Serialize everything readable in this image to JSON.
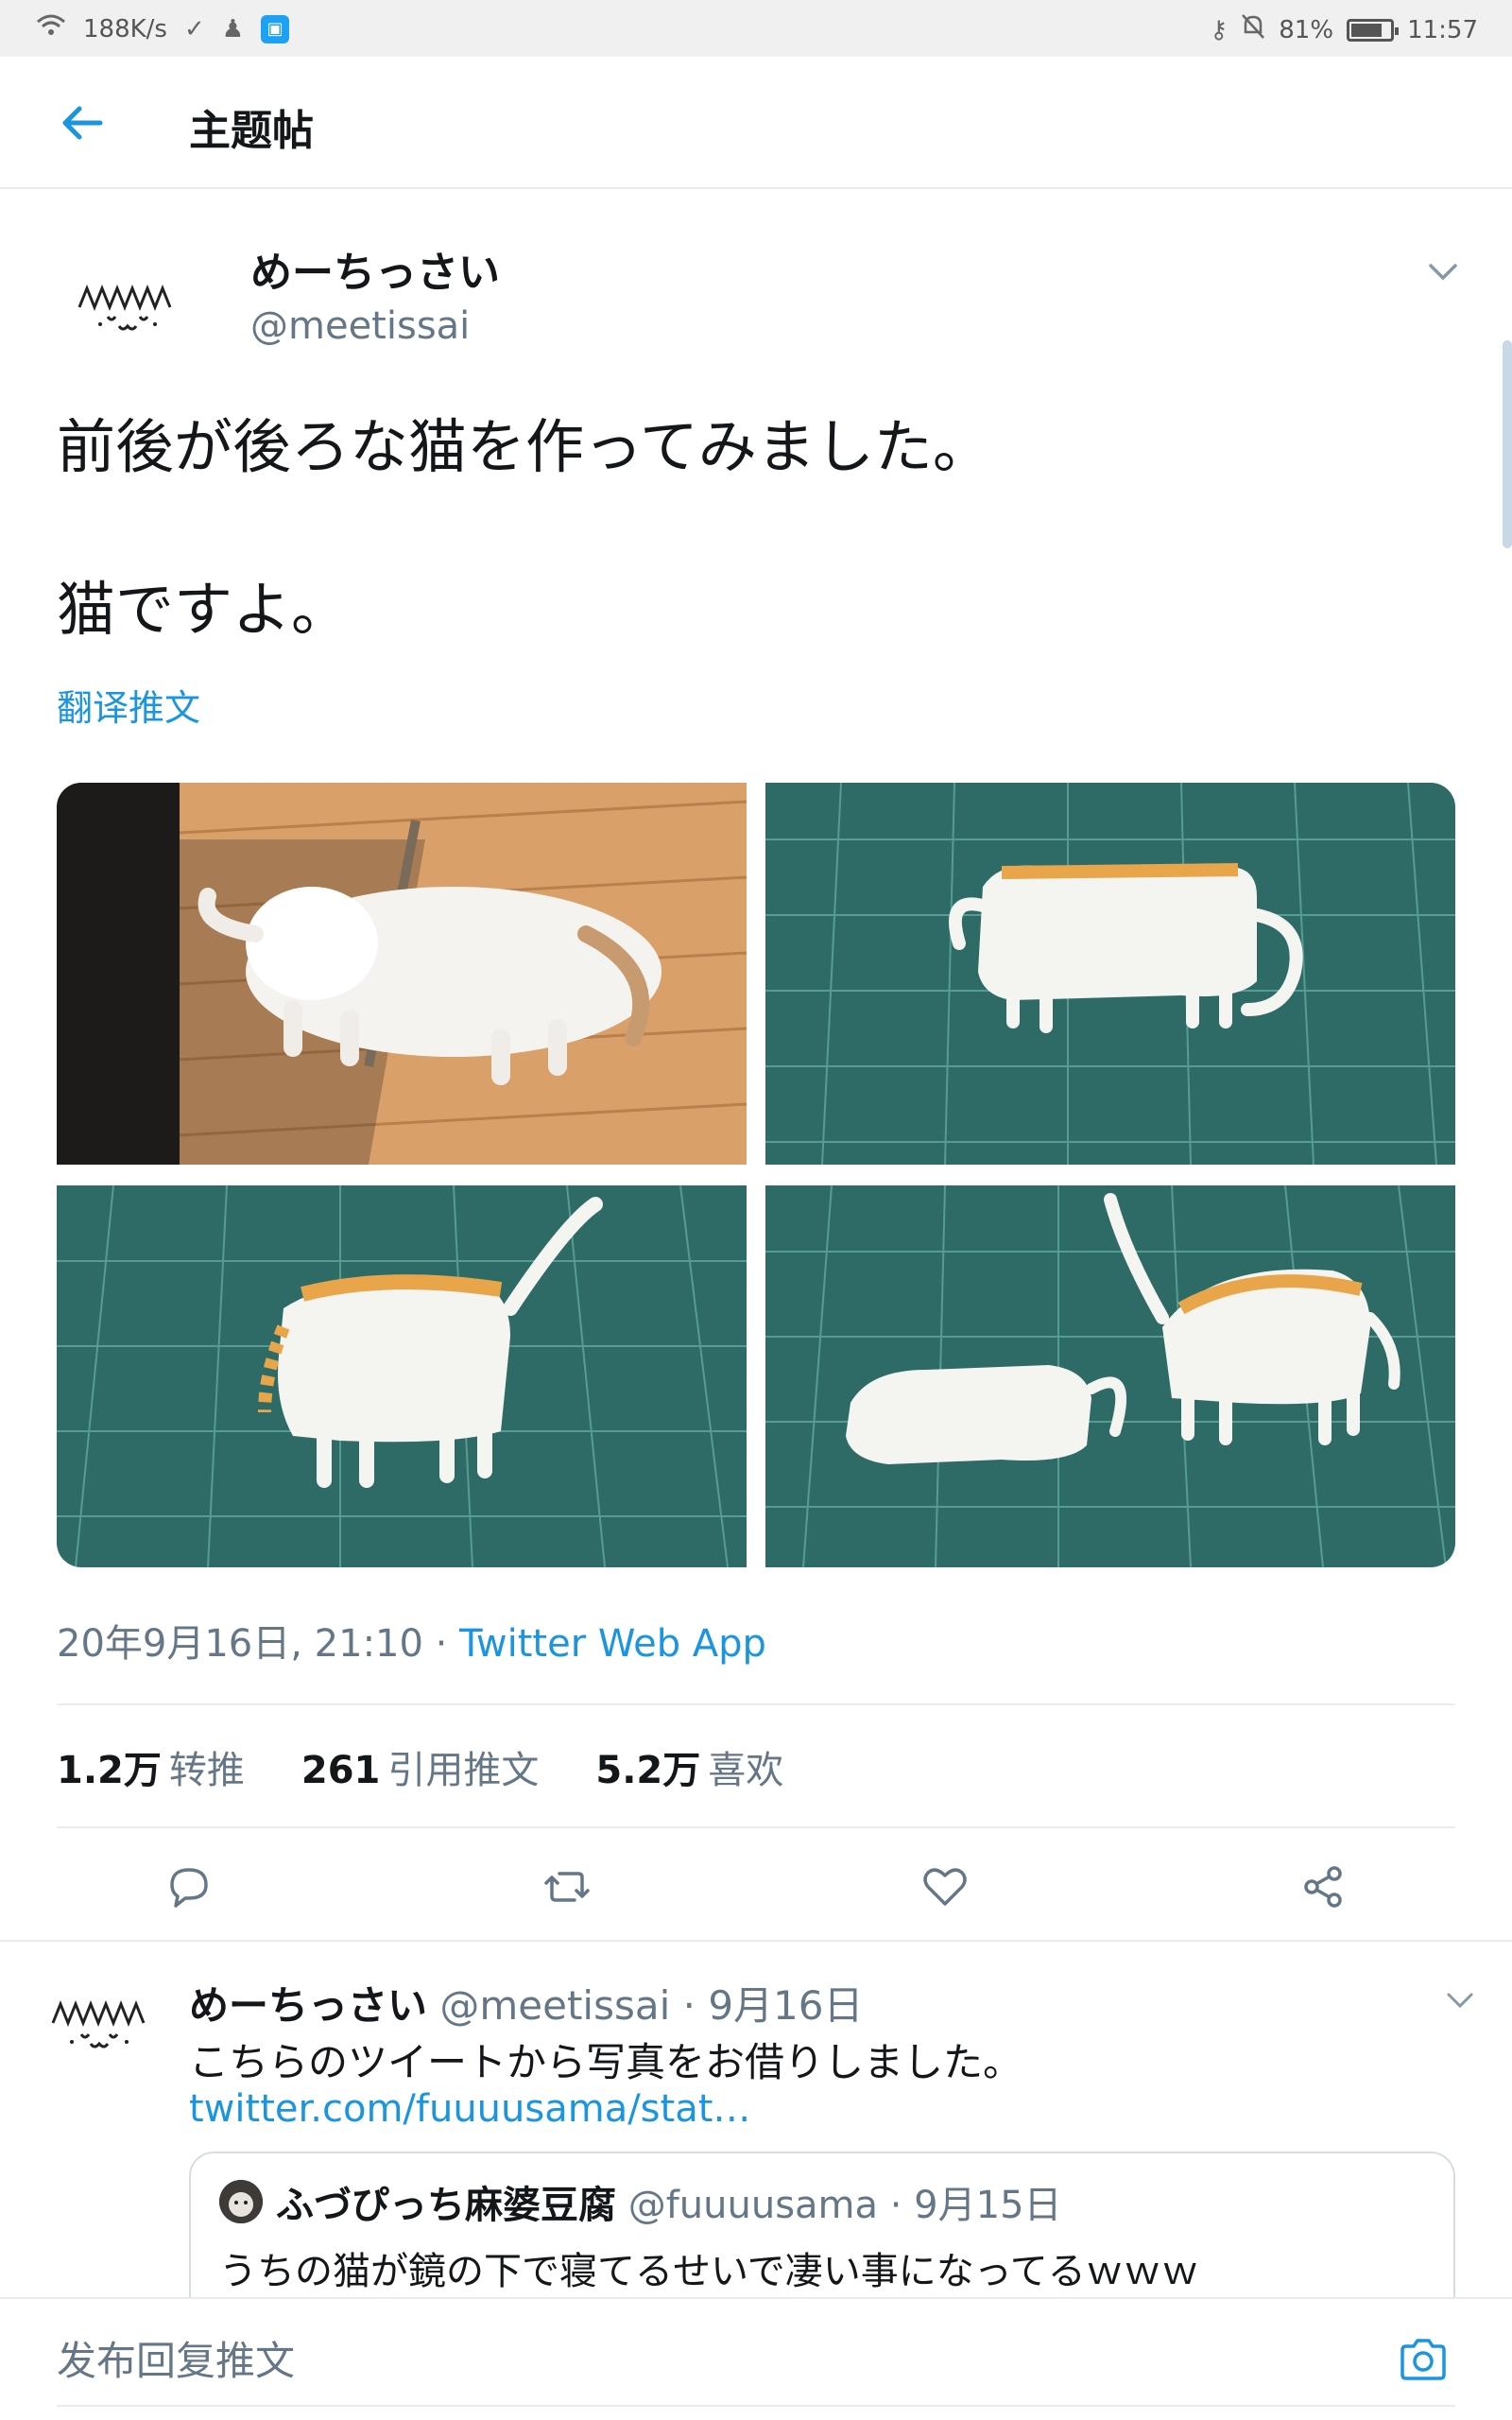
{
  "status_bar": {
    "net_speed": "188K/s",
    "battery_percent": "81%",
    "battery_level": 0.81,
    "time": "11:57"
  },
  "header": {
    "title": "主题帖"
  },
  "tweet": {
    "display_name": "めーちっさい",
    "handle": "@meetissai",
    "text": "前後が後ろな猫を作ってみました。\n\n猫ですよ。",
    "translate_label": "翻译推文",
    "timestamp": "20年9月16日, 21:10 · ",
    "source": "Twitter Web App",
    "stats": [
      {
        "count": "1.2万",
        "label": "转推"
      },
      {
        "count": "261",
        "label": "引用推文"
      },
      {
        "count": "5.2万",
        "label": "喜欢"
      }
    ]
  },
  "reply": {
    "display_name": "めーちっさい",
    "handle_date": " @meetissai · 9月16日",
    "text": "こちらのツイートから写真をお借りしました。",
    "link": "twitter.com/fuuuusama/stat…",
    "quote": {
      "display_name": "ふづぴっち麻婆豆腐",
      "handle_date": " @fuuuusama · 9月15日",
      "text": "うちの猫が鏡の下で寝てるせいで凄い事になってるｗｗｗ"
    }
  },
  "compose": {
    "placeholder": "发布回复推文"
  },
  "colors": {
    "accent": "#1b95e0",
    "secondary_text": "#657786",
    "mat_green": "#2f6b66"
  }
}
